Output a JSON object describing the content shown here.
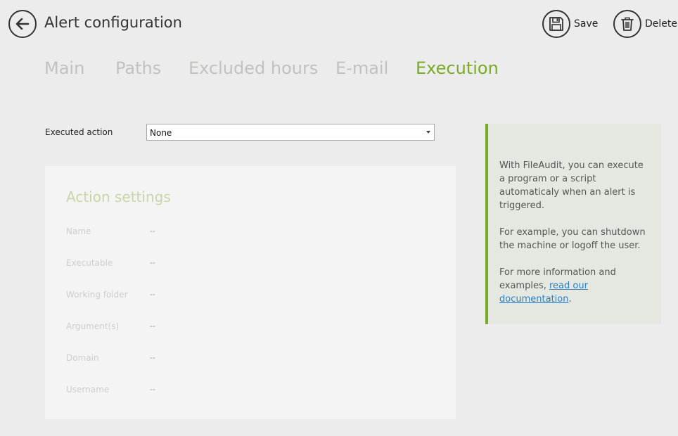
{
  "header": {
    "title": "Alert configuration",
    "save_label": "Save",
    "delete_label": "Delete"
  },
  "tabs": [
    {
      "label": "Main",
      "active": false
    },
    {
      "label": "Paths",
      "active": false
    },
    {
      "label": "Excluded hours",
      "active": false
    },
    {
      "label": "E-mail",
      "active": false
    },
    {
      "label": "Execution",
      "active": true
    }
  ],
  "executed_action": {
    "label": "Executed action",
    "value": "None"
  },
  "action_settings": {
    "title": "Action settings",
    "rows": [
      {
        "label": "Name",
        "value": "--"
      },
      {
        "label": "Executable",
        "value": "--"
      },
      {
        "label": "Working folder",
        "value": "--"
      },
      {
        "label": "Argument(s)",
        "value": "--"
      },
      {
        "label": "Domain",
        "value": "--"
      },
      {
        "label": "Username",
        "value": "--"
      }
    ]
  },
  "info": {
    "p1": "With FileAudit, you can execute a program or a script automaticaly when an alert is triggered.",
    "p2": "For example, you can shutdown the machine or logoff the user.",
    "p3_prefix": "For more information and examples, ",
    "link": "read our documentation",
    "p3_suffix": "."
  },
  "colors": {
    "accent": "#7aab28",
    "tab_inactive": "#bfc3bb",
    "link": "#2a7fc0"
  },
  "icons": {
    "back": "back-arrow-icon",
    "save": "floppy-disk-icon",
    "delete": "trash-icon"
  }
}
